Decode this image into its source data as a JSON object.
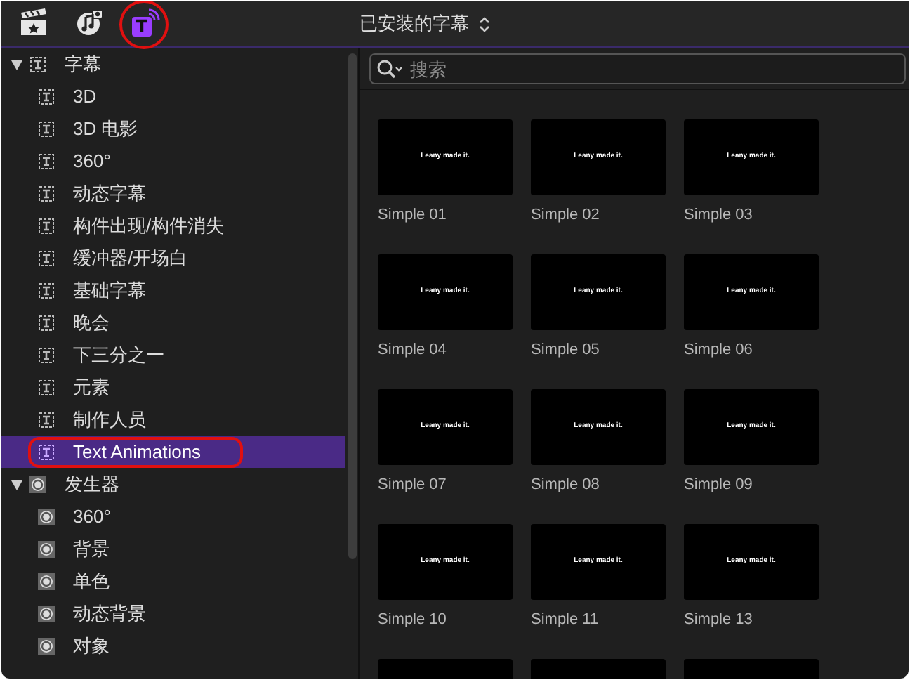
{
  "toolbar": {
    "buttons": [
      {
        "kind": "clapper",
        "selected": false
      },
      {
        "kind": "music",
        "selected": false
      },
      {
        "kind": "titles",
        "selected": true,
        "annotated": true
      }
    ],
    "title": "已安装的字幕"
  },
  "sidebar": {
    "groups": [
      {
        "label": "字幕",
        "kind": "titles",
        "expanded": true,
        "children": [
          {
            "label": "3D",
            "selected": false,
            "annotated": false
          },
          {
            "label": "3D 电影",
            "selected": false,
            "annotated": false
          },
          {
            "label": "360°",
            "selected": false,
            "annotated": false
          },
          {
            "label": "动态字幕",
            "selected": false,
            "annotated": false
          },
          {
            "label": "构件出现/构件消失",
            "selected": false,
            "annotated": false
          },
          {
            "label": "缓冲器/开场白",
            "selected": false,
            "annotated": false
          },
          {
            "label": "基础字幕",
            "selected": false,
            "annotated": false
          },
          {
            "label": "晚会",
            "selected": false,
            "annotated": false
          },
          {
            "label": "下三分之一",
            "selected": false,
            "annotated": false
          },
          {
            "label": "元素",
            "selected": false,
            "annotated": false
          },
          {
            "label": "制作人员",
            "selected": false,
            "annotated": false
          },
          {
            "label": "Text Animations",
            "selected": true,
            "annotated": true
          }
        ]
      },
      {
        "label": "发生器",
        "kind": "generators",
        "expanded": true,
        "children": [
          {
            "label": "360°",
            "selected": false,
            "annotated": false
          },
          {
            "label": "背景",
            "selected": false,
            "annotated": false
          },
          {
            "label": "单色",
            "selected": false,
            "annotated": false
          },
          {
            "label": "动态背景",
            "selected": false,
            "annotated": false
          },
          {
            "label": "对象",
            "selected": false,
            "annotated": false
          }
        ]
      }
    ]
  },
  "search": {
    "placeholder": "搜索"
  },
  "browser": {
    "items": [
      {
        "kind": "full",
        "preview_text": "Leany made it.",
        "label": "Simple 01"
      },
      {
        "kind": "full",
        "preview_text": "Leany made it.",
        "label": "Simple 02"
      },
      {
        "kind": "full",
        "preview_text": "Leany made it.",
        "label": "Simple 03"
      },
      {
        "kind": "full",
        "preview_text": "Leany made it.",
        "label": "Simple 04"
      },
      {
        "kind": "full",
        "preview_text": "Leany made it.",
        "label": "Simple 05"
      },
      {
        "kind": "full",
        "preview_text": "Leany made it.",
        "label": "Simple 06"
      },
      {
        "kind": "full",
        "preview_text": "Leany made it.",
        "label": "Simple 07"
      },
      {
        "kind": "full",
        "preview_text": "Leany made it.",
        "label": "Simple 08"
      },
      {
        "kind": "full",
        "preview_text": "Leany made it.",
        "label": "Simple 09"
      },
      {
        "kind": "full",
        "preview_text": "Leany made it.",
        "label": "Simple 10"
      },
      {
        "kind": "full",
        "preview_text": "Leany made it.",
        "label": "Simple 11"
      },
      {
        "kind": "full",
        "preview_text": "Leany made it.",
        "label": "Simple 13"
      },
      {
        "kind": "partial"
      },
      {
        "kind": "partial"
      },
      {
        "kind": "partial"
      }
    ]
  }
}
